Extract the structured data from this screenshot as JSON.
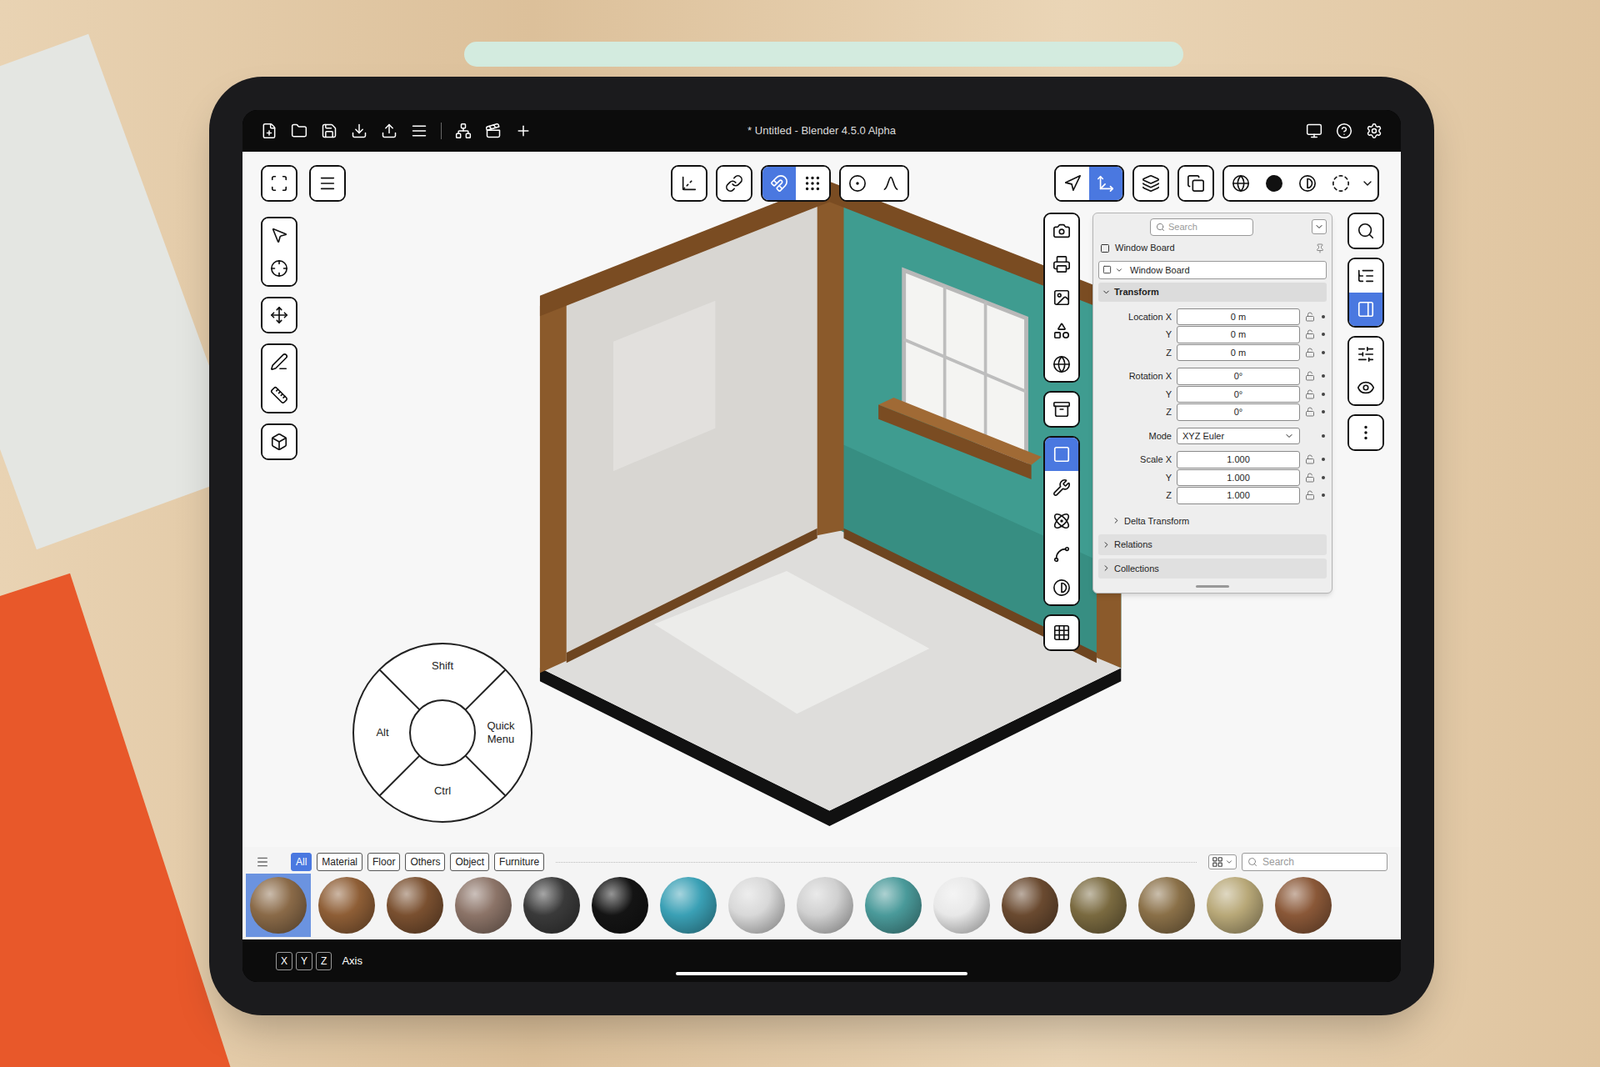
{
  "window": {
    "title": "* Untitled - Blender 4.5.0 Alpha"
  },
  "corner_buttons": [
    {
      "selected": false
    },
    {
      "selected": false
    }
  ],
  "left_tools": [
    {
      "selected": false
    },
    {
      "selected": false
    },
    {
      "selected": false
    },
    {
      "selected": false
    },
    {
      "selected": false
    },
    {
      "selected": false
    }
  ],
  "top_toolbar": [
    {
      "selected": false
    },
    {
      "selected": false
    },
    {
      "selected": true
    },
    {
      "selected": false
    },
    {
      "selected": false
    },
    {
      "selected": false
    }
  ],
  "view_toolbar": [
    {
      "selected": false
    },
    {
      "selected": true
    },
    {
      "selected": false
    },
    {
      "selected": false
    },
    {
      "selected": false
    },
    {
      "selected": false
    },
    {
      "selected": false
    },
    {
      "selected": false
    }
  ],
  "property_tabs": [
    {
      "selected": false
    },
    {
      "selected": false
    },
    {
      "selected": false
    },
    {
      "selected": false
    },
    {
      "selected": false
    },
    {
      "selected": false
    },
    {
      "selected": true
    },
    {
      "selected": false
    },
    {
      "selected": false
    },
    {
      "selected": false
    },
    {
      "selected": false
    },
    {
      "selected": false
    }
  ],
  "side_column": [
    {
      "selected": false
    },
    {
      "selected": false
    },
    {
      "selected": true
    },
    {
      "selected": false
    },
    {
      "selected": false
    },
    {
      "selected": false
    }
  ],
  "properties": {
    "search": {
      "placeholder": "Search"
    },
    "object_name": "Window Board",
    "data_name": "Window Board",
    "transform": {
      "label": "Transform",
      "expanded": true,
      "groups": [
        {
          "rows": [
            {
              "label": "Location X",
              "value": "0 m",
              "kind": "number"
            },
            {
              "label": "Y",
              "value": "0 m",
              "kind": "number"
            },
            {
              "label": "Z",
              "value": "0 m",
              "kind": "number"
            }
          ]
        },
        {
          "rows": [
            {
              "label": "Rotation X",
              "value": "0°",
              "kind": "number"
            },
            {
              "label": "Y",
              "value": "0°",
              "kind": "number"
            },
            {
              "label": "Z",
              "value": "0°",
              "kind": "number"
            }
          ]
        },
        {
          "rows": [
            {
              "label": "Mode",
              "value": "XYZ Euler",
              "kind": "dropdown"
            }
          ]
        },
        {
          "rows": [
            {
              "label": "Scale X",
              "value": "1.000",
              "kind": "number"
            },
            {
              "label": "Y",
              "value": "1.000",
              "kind": "number"
            },
            {
              "label": "Z",
              "value": "1.000",
              "kind": "number"
            }
          ]
        }
      ]
    },
    "subpanels": [
      {
        "label": "Delta Transform",
        "expanded": false,
        "nested": true
      },
      {
        "label": "Relations",
        "expanded": false,
        "nested": false
      },
      {
        "label": "Collections",
        "expanded": false,
        "nested": false
      }
    ]
  },
  "pie_menu": {
    "items": [
      {
        "label": "Shift"
      },
      {
        "label": "Quick Menu"
      },
      {
        "label": "Ctrl"
      },
      {
        "label": "Alt"
      }
    ]
  },
  "asset_browser": {
    "tabs": [
      {
        "label": "All",
        "selected": true
      },
      {
        "label": "Material",
        "selected": false
      },
      {
        "label": "Floor",
        "selected": false
      },
      {
        "label": "Others",
        "selected": false
      },
      {
        "label": "Object",
        "selected": false
      },
      {
        "label": "Furniture",
        "selected": false
      }
    ],
    "search": {
      "placeholder": "Search"
    },
    "items": [
      {
        "color": "#8a6a48",
        "selected": true
      },
      {
        "color": "#8e5e36",
        "selected": false
      },
      {
        "color": "#7a5030",
        "selected": false
      },
      {
        "color": "#8c7468",
        "selected": false
      },
      {
        "color": "#3a3a3a",
        "selected": false
      },
      {
        "color": "#141414",
        "selected": false
      },
      {
        "color": "#3aa0b5",
        "selected": false
      },
      {
        "color": "#d8d8d8",
        "selected": false
      },
      {
        "color": "#d0d0d0",
        "selected": false
      },
      {
        "color": "#4a9a9a",
        "selected": false
      },
      {
        "color": "#e8e8e8",
        "selected": false
      },
      {
        "color": "#6a4a30",
        "selected": false
      },
      {
        "color": "#7a6a40",
        "selected": false
      },
      {
        "color": "#8a7048",
        "selected": false
      },
      {
        "color": "#b8a878",
        "selected": false
      },
      {
        "color": "#8a5838",
        "selected": false
      }
    ]
  },
  "status_bar": {
    "keys": [
      "X",
      "Y",
      "Z"
    ],
    "label": "Axis"
  }
}
